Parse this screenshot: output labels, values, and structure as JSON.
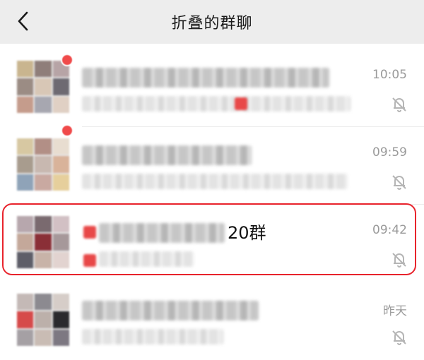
{
  "header": {
    "title": "折叠的群聊",
    "back_icon": "chevron-left-icon"
  },
  "chats": [
    {
      "name_visible": "",
      "time": "10:05",
      "muted": true,
      "has_unread_dot": true
    },
    {
      "name_visible": "",
      "time": "09:59",
      "muted": true,
      "has_unread_dot": true
    },
    {
      "name_visible": "20群",
      "time": "09:42",
      "muted": true,
      "has_unread_dot": false,
      "highlighted": true
    },
    {
      "name_visible": "",
      "time": "昨天",
      "muted": true,
      "has_unread_dot": false
    }
  ],
  "colors": {
    "header_bg": "#ededed",
    "highlight_border": "#e8232c",
    "unread_red": "#f04a4a",
    "time_gray": "#9a9a9a"
  }
}
